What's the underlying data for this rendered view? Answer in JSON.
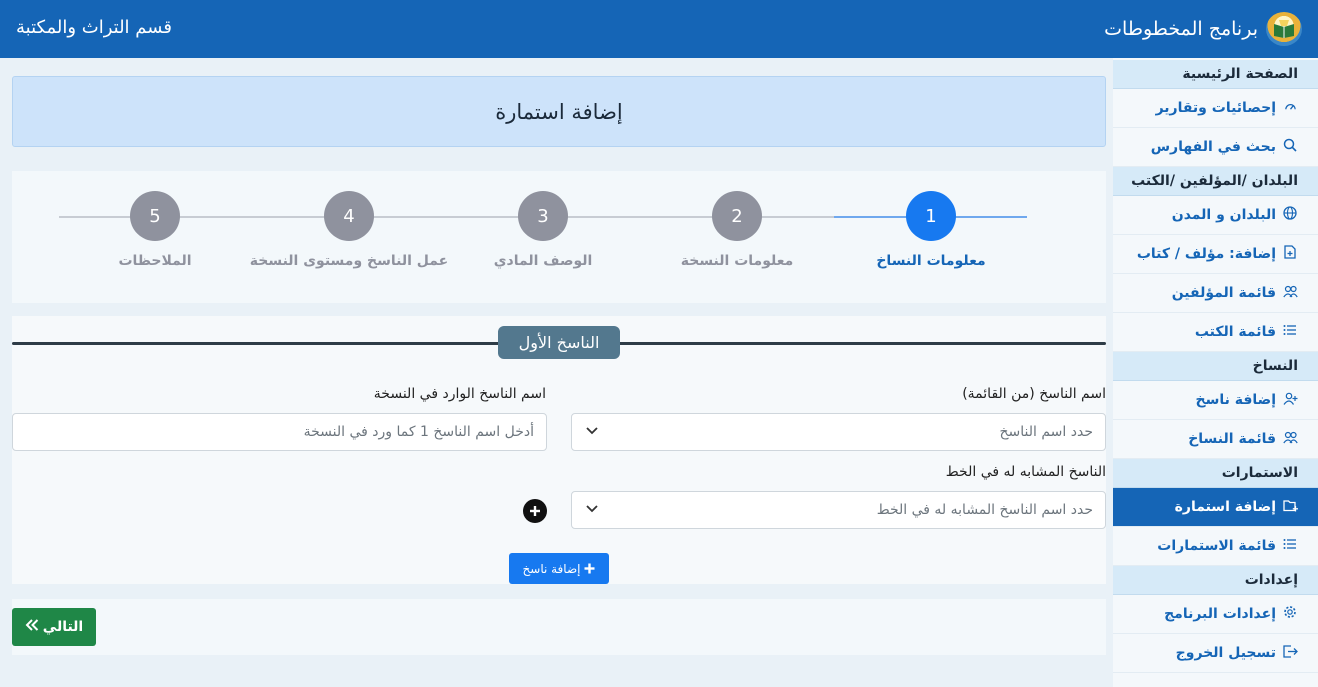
{
  "header": {
    "app_title": "برنامج المخطوطات",
    "department": "قسم التراث والمكتبة",
    "logo_icon": "book-logo-icon"
  },
  "sidebar": {
    "sections": [
      {
        "title": "الصفحة الرئيسية",
        "items": [
          {
            "label": "إحصائيات وتقارير",
            "icon": "dashboard-icon"
          },
          {
            "label": "بحث في الفهارس",
            "icon": "search-icon"
          }
        ]
      },
      {
        "title": "البلدان /المؤلفين /الكتب",
        "items": [
          {
            "label": "البلدان و المدن",
            "icon": "globe-icon"
          },
          {
            "label": "إضافة: مؤلف / كتاب",
            "icon": "file-plus-icon"
          },
          {
            "label": "قائمة المؤلفين",
            "icon": "people-icon"
          },
          {
            "label": "قائمة الكتب",
            "icon": "list-icon"
          }
        ]
      },
      {
        "title": "النساخ",
        "items": [
          {
            "label": "إضافة ناسخ",
            "icon": "person-add-icon"
          },
          {
            "label": "قائمة النساخ",
            "icon": "people-icon"
          }
        ]
      },
      {
        "title": "الاستمارات",
        "items": [
          {
            "label": "إضافة استمارة",
            "icon": "folder-plus-icon",
            "active": true
          },
          {
            "label": "قائمة الاستمارات",
            "icon": "list-icon"
          }
        ]
      },
      {
        "title": "إعدادات",
        "items": [
          {
            "label": "إعدادات البرنامج",
            "icon": "gear-icon"
          },
          {
            "label": "تسجيل الخروج",
            "icon": "logout-icon"
          }
        ]
      }
    ]
  },
  "main": {
    "page_title": "إضافة استمارة",
    "steps": [
      {
        "number": "1",
        "label": "معلومات النساخ",
        "active": true
      },
      {
        "number": "2",
        "label": "معلومات النسخة"
      },
      {
        "number": "3",
        "label": "الوصف المادي"
      },
      {
        "number": "4",
        "label": "عمل الناسخ ومستوى النسخة"
      },
      {
        "number": "5",
        "label": "الملاحظات"
      }
    ],
    "form": {
      "legend": "الناسخ الأول",
      "copyist_list_label": "اسم الناسخ (من القائمة)",
      "copyist_list_placeholder": "حدد اسم الناسخ",
      "copyist_name_label": "اسم الناسخ الوارد في النسخة",
      "copyist_name_placeholder": "أدخل اسم الناسخ 1 كما ورد في النسخة",
      "similar_label": "الناسخ المشابه له في الخط",
      "similar_placeholder": "حدد اسم الناسخ المشابه له في الخط",
      "add_copyist_label": "إضافة ناسخ"
    },
    "next_label": "التالي"
  }
}
